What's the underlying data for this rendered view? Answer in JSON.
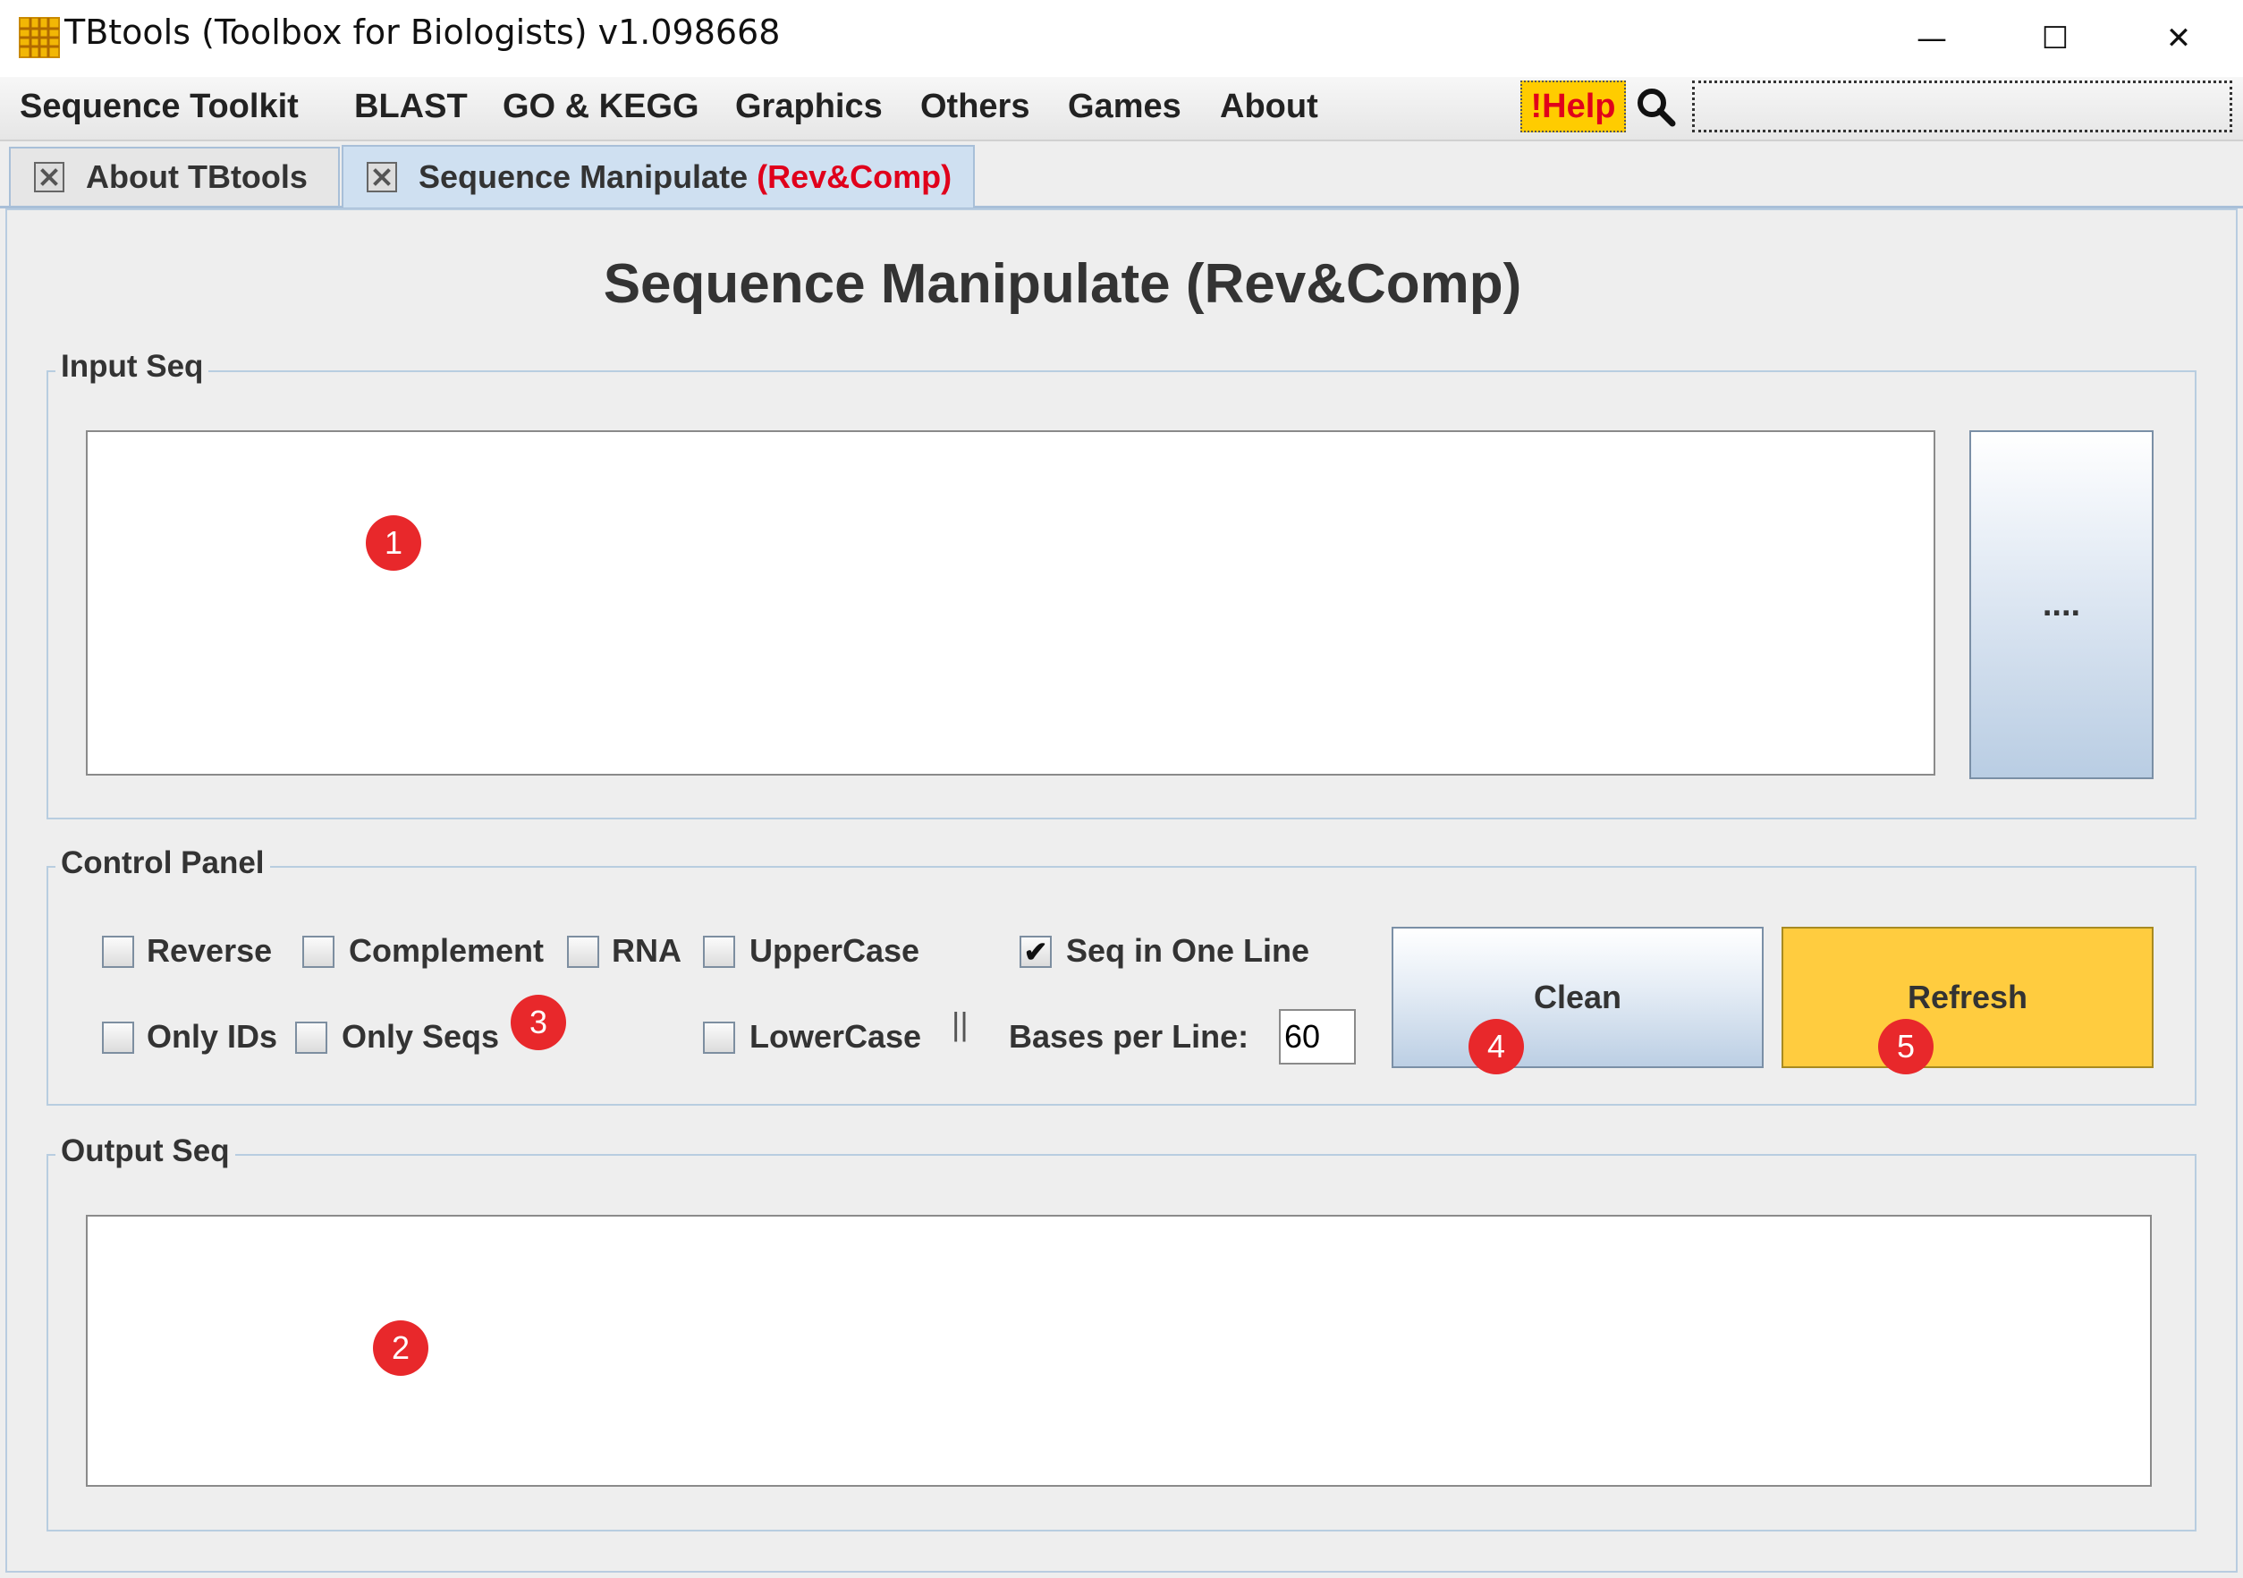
{
  "window": {
    "title": "TBtools (Toolbox for Biologists) v1.098668",
    "controls": {
      "minimize": "—",
      "maximize": "☐",
      "close": "✕"
    }
  },
  "menu": {
    "items": [
      "Sequence Toolkit",
      "BLAST",
      "GO & KEGG",
      "Graphics",
      "Others",
      "Games",
      "About"
    ],
    "help_label": "!Help",
    "search_placeholder": ""
  },
  "tabs": [
    {
      "label": "About TBtools",
      "active": false
    },
    {
      "label": "Sequence Manipulate ",
      "highlight": "(Rev&Comp)",
      "active": true
    }
  ],
  "page": {
    "title": "Sequence Manipulate (Rev&Comp)"
  },
  "input_group": {
    "label": "Input Seq",
    "value": "",
    "browse_label": "...."
  },
  "control_panel": {
    "label": "Control Panel",
    "checkboxes": [
      {
        "label": "Reverse",
        "checked": false
      },
      {
        "label": "Complement",
        "checked": false
      },
      {
        "label": "RNA",
        "checked": false
      },
      {
        "label": "UpperCase",
        "checked": false
      },
      {
        "label": "Seq in One Line",
        "checked": true
      },
      {
        "label": "Only IDs",
        "checked": false
      },
      {
        "label": "Only Seqs",
        "checked": false
      },
      {
        "label": "LowerCase",
        "checked": false
      }
    ],
    "separator": "||",
    "bases_per_line_label": "Bases per Line:",
    "bases_per_line_value": "60",
    "clean_label": "Clean",
    "refresh_label": "Refresh"
  },
  "output_group": {
    "label": "Output Seq",
    "value": ""
  },
  "annotations": [
    "1",
    "2",
    "3",
    "4",
    "5"
  ],
  "colors": {
    "accent_yellow": "#ffcc3f",
    "help_red": "#e0001b",
    "badge_red": "#e8282b",
    "tab_border": "#a8bfd8"
  }
}
